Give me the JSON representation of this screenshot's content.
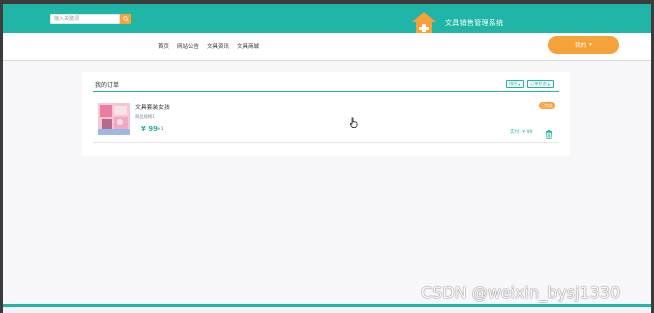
{
  "header": {
    "search_placeholder": "输入关键词",
    "site_title": "文具销售管理系统",
    "colors": {
      "brand": "#20b5a6",
      "accent": "#f7a13a"
    }
  },
  "nav": {
    "links": [
      "首页",
      "网站公告",
      "文具资讯",
      "文具商城"
    ],
    "login_label": "我的",
    "login_caret": "▾"
  },
  "orders": {
    "title": "我的订单",
    "sort_label": "排序",
    "status_filter_label": "订单状态",
    "items": [
      {
        "name": "文具套装女孩",
        "spec": "商品规格1",
        "price": "¥ 99",
        "qty": "×1",
        "status": "已完成",
        "paid": "实付: ¥ 99"
      }
    ]
  },
  "watermark": "CSDN @weixin_bysj1330"
}
